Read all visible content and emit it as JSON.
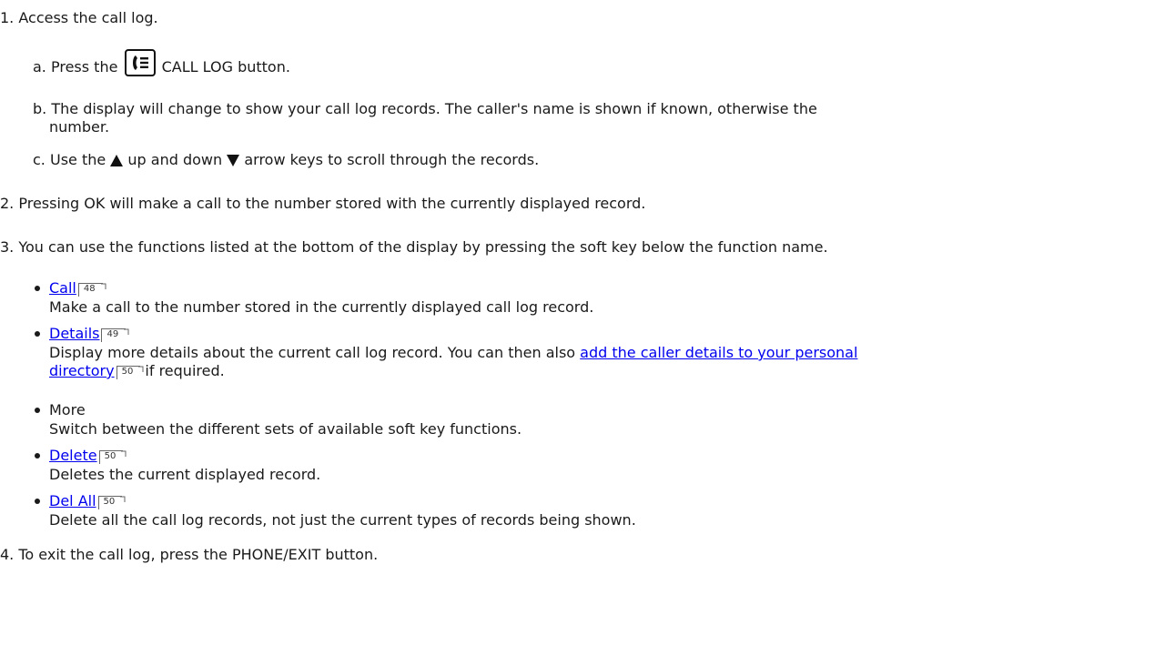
{
  "steps": [
    {
      "num": "1.",
      "text": "Access the call log."
    },
    {
      "num": "2.",
      "text": "Pressing OK will make a call to the number stored with the currently displayed record."
    },
    {
      "num": "3.",
      "text": "You can use the functions listed at the bottom of the display by pressing the soft key below the function name."
    },
    {
      "num": "4.",
      "text": "To exit the call log, press the PHONE/EXIT button."
    }
  ],
  "substeps": {
    "a": {
      "label": "a.",
      "pre": "Press the",
      "post": "CALL LOG button.",
      "icon": "call-log-icon"
    },
    "b": {
      "label": "b.",
      "line1": "The display will change to show your call log records. The caller's name is shown if known, otherwise the",
      "line2": "number."
    },
    "c": {
      "label": "c.",
      "pre": "Use the",
      "mid": "up and down",
      "post": "arrow keys to scroll through the records.",
      "icon_up": "up-triangle-icon",
      "icon_down": "down-triangle-icon"
    }
  },
  "functions": [
    {
      "name": "Call",
      "ref": "48",
      "desc": "Make a call to the number stored in the currently displayed call log record."
    },
    {
      "name": "Details",
      "ref": "49",
      "desc": "Display more details about the current call log record. You can then also",
      "link": "add the caller details to your personal",
      "link2": "directory",
      "link_ref": "50",
      "tail": "if required."
    },
    {
      "name": "More",
      "desc": "Switch between the different sets of available soft key functions."
    },
    {
      "name": "Delete",
      "ref": "50",
      "desc": "Deletes the current displayed record."
    },
    {
      "name": "Del All",
      "ref": "50",
      "desc": "Delete all the call log records, not just the current types of records being shown."
    }
  ],
  "colors": {
    "text": "#1a1a1a",
    "link": "#0000ee"
  }
}
